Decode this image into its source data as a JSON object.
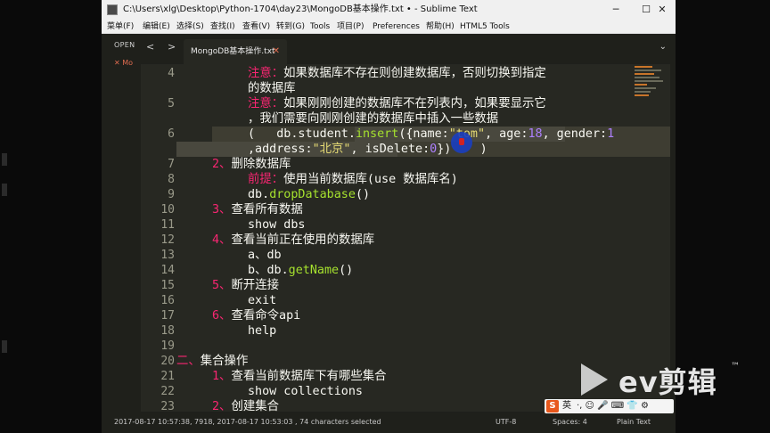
{
  "window": {
    "title": "C:\\Users\\xlg\\Desktop\\Python-1704\\day23\\MongoDB基本操作.txt • - Sublime Text",
    "minimize": "─",
    "maximize": "☐",
    "close": "✕"
  },
  "menu": [
    "菜单(F)",
    "编辑(E)",
    "选择(S)",
    "查找(I)",
    "查看(V)",
    "转到(G)",
    "Tools",
    "项目(P)",
    "Preferences",
    "帮助(H)",
    "HTML5 Tools"
  ],
  "sidebar": {
    "open_label": "OPEN",
    "open_file": "✕ Mo"
  },
  "tabbar": {
    "back": "<",
    "forward": ">",
    "tab_label": "MongoDB基本操作.txt",
    "tab_close": "✕",
    "dropdown": "⌄"
  },
  "editor": {
    "lines": [
      {
        "n": "4",
        "segs": [
          [
            "kw",
            "注意："
          ],
          [
            "",
            "如果数据库不存在则创建数据库，否则切换到指定"
          ]
        ]
      },
      {
        "n": "",
        "segs": [
          [
            "",
            "的数据库"
          ]
        ]
      },
      {
        "n": "5",
        "segs": [
          [
            "kw",
            "注意："
          ],
          [
            "",
            "如果刚刚创建的数据库不在列表内，如果要显示它"
          ]
        ]
      },
      {
        "n": "",
        "segs": [
          [
            "",
            "，我们需要向刚刚创建的数据库中插入一些数据"
          ]
        ]
      },
      {
        "n": "6",
        "segs": [
          [
            "",
            "(   db.student."
          ],
          [
            "fn",
            "insert"
          ],
          [
            "",
            "({name:"
          ],
          [
            "str",
            "\"tom\""
          ],
          [
            "",
            ", age:"
          ],
          [
            "num",
            "18"
          ],
          [
            "",
            ", gender:"
          ],
          [
            "num",
            "1"
          ]
        ]
      },
      {
        "n": "",
        "segs": [
          [
            "",
            ",address:"
          ],
          [
            "str",
            "\"北京\""
          ],
          [
            "",
            ", isDelete:"
          ],
          [
            "num",
            "0"
          ],
          [
            "",
            "})    )"
          ]
        ]
      },
      {
        "n": "7",
        "segs": [
          [
            "kw",
            "2、"
          ],
          [
            "",
            "删除数据库"
          ]
        ]
      },
      {
        "n": "8",
        "segs": [
          [
            "kw",
            "前提："
          ],
          [
            "",
            "使用当前数据库(use 数据库名)"
          ]
        ]
      },
      {
        "n": "9",
        "segs": [
          [
            "",
            "db."
          ],
          [
            "fn",
            "dropDatabase"
          ],
          [
            "",
            "()"
          ]
        ]
      },
      {
        "n": "10",
        "segs": [
          [
            "kw",
            "3、"
          ],
          [
            "",
            "查看所有数据"
          ]
        ]
      },
      {
        "n": "11",
        "segs": [
          [
            "",
            "show dbs"
          ]
        ]
      },
      {
        "n": "12",
        "segs": [
          [
            "kw",
            "4、"
          ],
          [
            "",
            "查看当前正在使用的数据库"
          ]
        ]
      },
      {
        "n": "13",
        "segs": [
          [
            "",
            "a、db"
          ]
        ]
      },
      {
        "n": "14",
        "segs": [
          [
            "",
            "b、db."
          ],
          [
            "fn",
            "getName"
          ],
          [
            "",
            "()"
          ]
        ]
      },
      {
        "n": "15",
        "segs": [
          [
            "kw",
            "5、"
          ],
          [
            "",
            "断开连接"
          ]
        ]
      },
      {
        "n": "16",
        "segs": [
          [
            "",
            "exit"
          ]
        ]
      },
      {
        "n": "17",
        "segs": [
          [
            "kw",
            "6、"
          ],
          [
            "",
            "查看命令api"
          ]
        ]
      },
      {
        "n": "18",
        "segs": [
          [
            "",
            "help"
          ]
        ]
      },
      {
        "n": "19",
        "segs": []
      },
      {
        "n": "20",
        "segs": [
          [
            "kw",
            "二、"
          ],
          [
            "",
            "集合操作"
          ]
        ]
      },
      {
        "n": "21",
        "segs": [
          [
            "kw",
            "1、"
          ],
          [
            "",
            "查看当前数据库下有哪些集合"
          ]
        ]
      },
      {
        "n": "22",
        "segs": [
          [
            "",
            "show collections"
          ]
        ]
      },
      {
        "n": "23",
        "segs": [
          [
            "kw",
            "2、"
          ],
          [
            "",
            "创建集合"
          ]
        ]
      }
    ]
  },
  "status": {
    "info": "2017-08-17 10:57:38, 7918, 2017-08-17 10:53:03 , 74 characters selected",
    "encoding": "UTF-8",
    "spaces": "Spaces: 4",
    "syntax": "Plain Text"
  },
  "ime": {
    "logo": "S",
    "lang": "英",
    "items": "·, ☺ 🎤 ⌨ 👕 ⚙"
  },
  "watermark": {
    "text": "ev剪辑",
    "tm": "™"
  },
  "colors": {
    "keyword": "#f92672",
    "function": "#a6e22e",
    "string": "#e6db74",
    "number": "#ae81ff",
    "background": "#272822"
  }
}
